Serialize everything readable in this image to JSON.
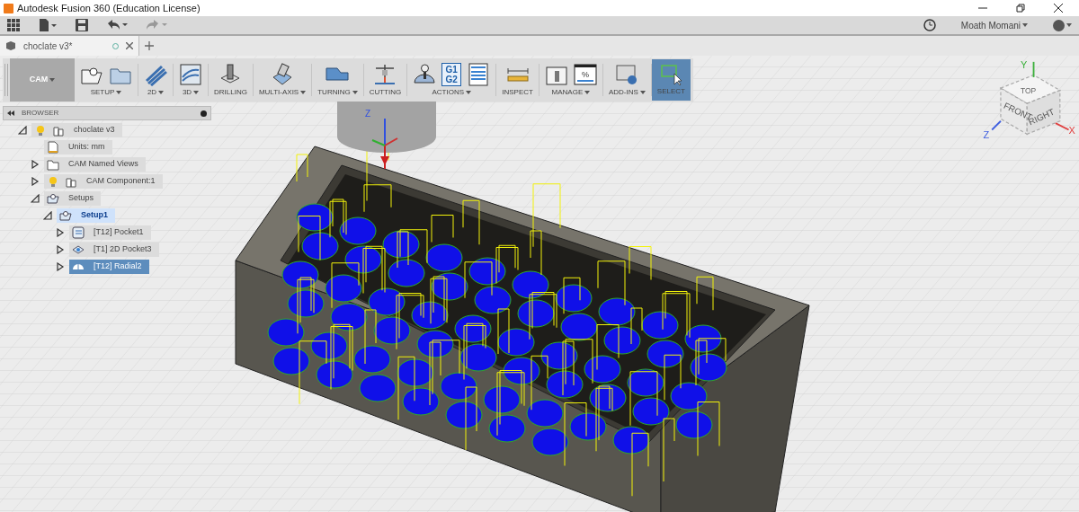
{
  "window": {
    "title": "Autodesk Fusion 360 (Education License)"
  },
  "quick_access": {
    "user": "Moath Momani"
  },
  "document_tabs": [
    {
      "label": "choclate v3*",
      "selected": true
    }
  ],
  "workspace": {
    "label": "CAM"
  },
  "toolbar_groups": [
    {
      "label": "SETUP",
      "dropdown": true,
      "selected": false
    },
    {
      "label": "2D",
      "dropdown": true,
      "selected": false
    },
    {
      "label": "3D",
      "dropdown": true,
      "selected": false
    },
    {
      "label": "DRILLING",
      "dropdown": false,
      "selected": false
    },
    {
      "label": "MULTI-AXIS",
      "dropdown": true,
      "selected": false
    },
    {
      "label": "TURNING",
      "dropdown": true,
      "selected": false
    },
    {
      "label": "CUTTING",
      "dropdown": false,
      "selected": false
    },
    {
      "label": "ACTIONS",
      "dropdown": true,
      "selected": false
    },
    {
      "label": "INSPECT",
      "dropdown": false,
      "selected": false
    },
    {
      "label": "MANAGE",
      "dropdown": true,
      "selected": false
    },
    {
      "label": "ADD-INS",
      "dropdown": true,
      "selected": false
    },
    {
      "label": "SELECT",
      "dropdown": false,
      "selected": true
    }
  ],
  "g_code_icon": {
    "line_1": "G1",
    "line_2": "G2"
  },
  "percent_icon": {
    "symbol": "%"
  },
  "browser": {
    "title": "BROWSER",
    "tree": [
      {
        "label": "choclate v3",
        "kind": "document",
        "expanded": true,
        "selected": false,
        "active": false,
        "children": [
          {
            "label": "Units: mm",
            "kind": "units",
            "selected": false,
            "active": false
          },
          {
            "label": "CAM Named Views",
            "kind": "folder",
            "expanded": false,
            "selected": false,
            "active": false
          },
          {
            "label": "CAM Component:1",
            "kind": "component",
            "expanded": false,
            "selected": false,
            "active": false
          },
          {
            "label": "Setups",
            "kind": "setups",
            "expanded": true,
            "selected": false,
            "active": false,
            "children": [
              {
                "label": "Setup1",
                "kind": "setup",
                "expanded": true,
                "selected": false,
                "active": true,
                "children": [
                  {
                    "label": "[T12] Pocket1",
                    "kind": "pocket",
                    "expanded": false,
                    "selected": false,
                    "active": false
                  },
                  {
                    "label": "[T1] 2D Pocket3",
                    "kind": "pocket2d",
                    "expanded": false,
                    "selected": false,
                    "active": false
                  },
                  {
                    "label": "[T12] Radial2",
                    "kind": "radial",
                    "expanded": false,
                    "selected": true,
                    "active": false
                  }
                ]
              }
            ]
          }
        ]
      }
    ]
  },
  "view_cube": {
    "top": "TOP",
    "front": "FRONT",
    "right": "RIGHT",
    "x_axis": "X",
    "y_axis": "Y",
    "z_axis": "Z"
  },
  "model_triad": {
    "z_axis": "Z"
  }
}
